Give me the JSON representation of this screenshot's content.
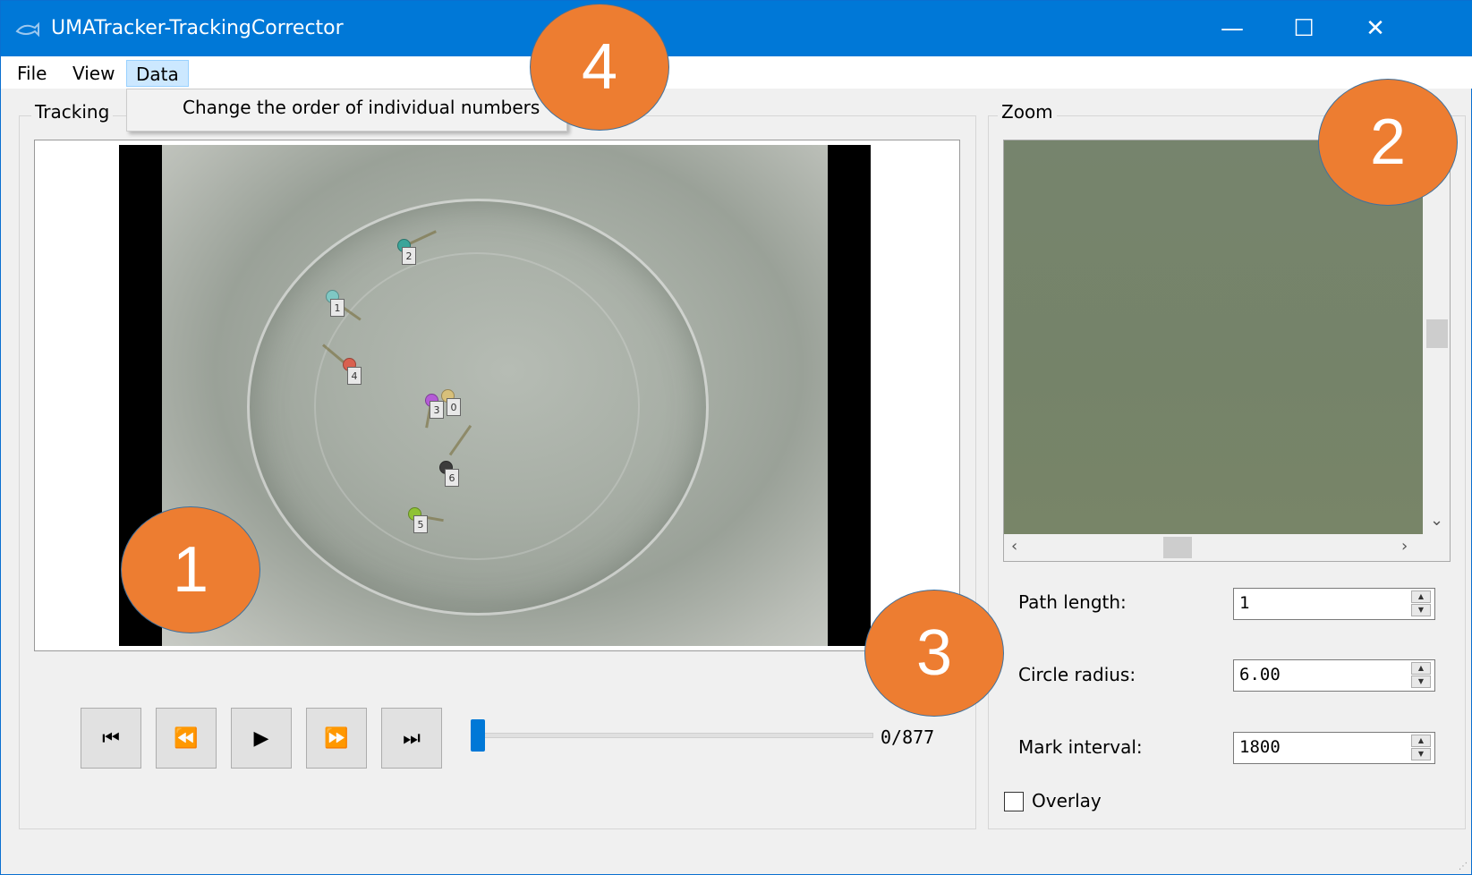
{
  "window": {
    "title": "UMATracker-TrackingCorrector",
    "controls": {
      "minimize": "—",
      "maximize": "☐",
      "close": "✕"
    }
  },
  "menu": {
    "items": [
      "File",
      "View",
      "Data"
    ],
    "active": "Data",
    "dropdown": [
      "Change the order of individual numbers"
    ]
  },
  "tracking": {
    "group_label": "Tracking",
    "fish_tags": [
      "2",
      "1",
      "4",
      "3",
      "0",
      "6",
      "5"
    ],
    "fish_colors": [
      "#3aa59a",
      "#7fc8c4",
      "#d9604f",
      "#b45bd6",
      "#d8c07a",
      "#3c3c3c",
      "#8fc235"
    ],
    "playback": {
      "first_icon": "skip-to-start-icon",
      "rewind_icon": "rewind-icon",
      "play_icon": "play-icon",
      "forward_icon": "fast-forward-icon",
      "last_icon": "skip-to-end-icon"
    },
    "frame_position": 0,
    "frame_total": 877,
    "frame_counter": "0/877"
  },
  "zoom": {
    "group_label": "Zoom",
    "path_length_label": "Path length:",
    "path_length_value": "1",
    "circle_radius_label": "Circle radius:",
    "circle_radius_value": "6.00",
    "mark_interval_label": "Mark interval:",
    "mark_interval_value": "1800",
    "overlay_label": "Overlay",
    "overlay_checked": false
  },
  "callouts": [
    "1",
    "2",
    "3",
    "4"
  ],
  "colors": {
    "titlebar": "#0078d7",
    "callout": "#ed7d31",
    "slider": "#0078d7"
  }
}
